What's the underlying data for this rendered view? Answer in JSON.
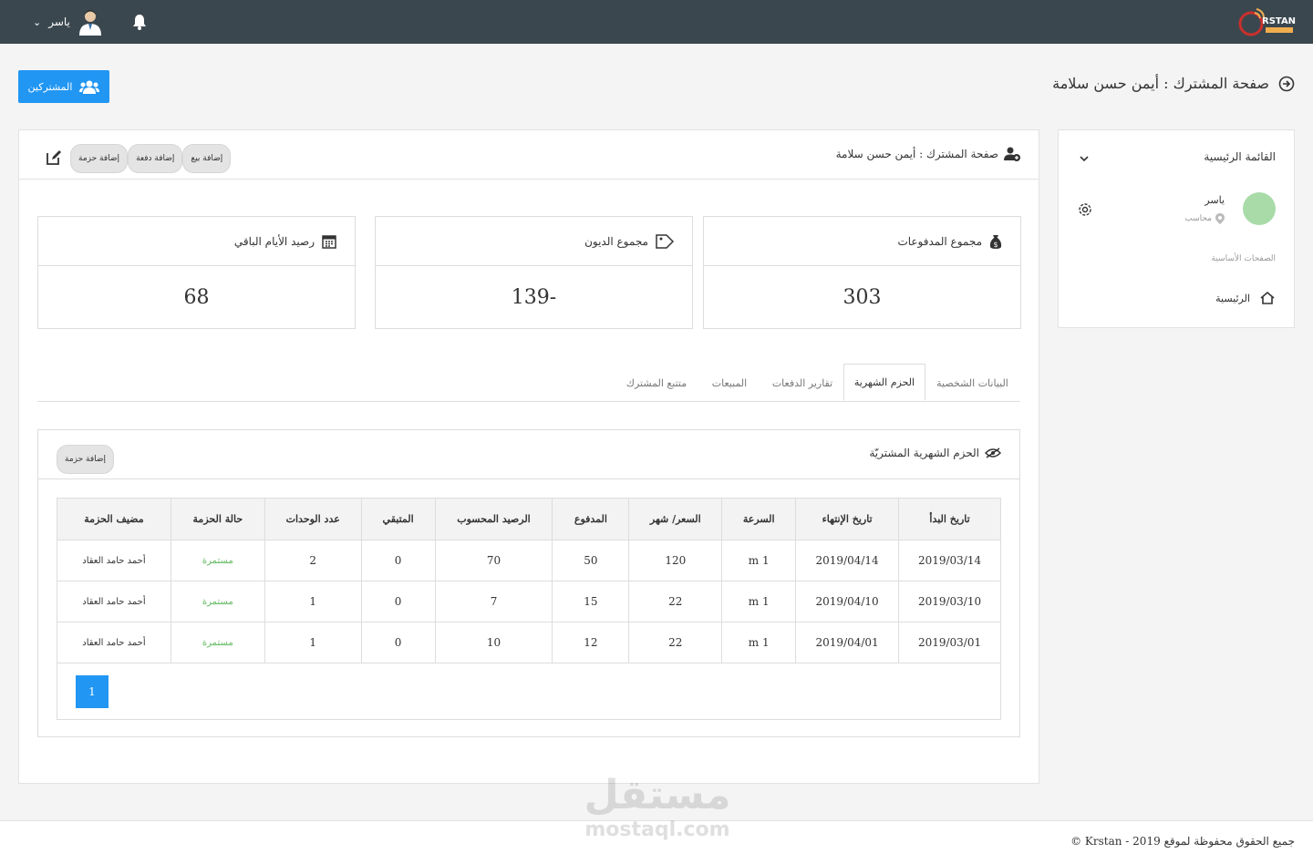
{
  "topbar": {
    "user_name": "ياسر"
  },
  "page": {
    "title": "صفحة المشترك : أيمن حسن سلامة",
    "subscribers_button": "المشتركين"
  },
  "sidebar": {
    "heading": "القائمة الرئيسية",
    "user_name": "ياسر",
    "user_role": "محاسب",
    "section_label": "الصفحات الأساسية",
    "home_label": "الرئيسية"
  },
  "card": {
    "title": "صفحة المشترك : أيمن حسن سلامة",
    "actions": [
      "إضافة بيع",
      "إضافة دفعة",
      "إضافة حزمة"
    ]
  },
  "stats": [
    {
      "label": "مجموع المدفوعات",
      "value": "303",
      "icon": "money-bag-icon"
    },
    {
      "label": "مجموع الديون",
      "value": "139-",
      "icon": "tag-icon"
    },
    {
      "label": "رصيد الأيام الباقي",
      "value": "68",
      "icon": "calendar-icon"
    }
  ],
  "tabs": [
    {
      "label": "البيانات الشخصية",
      "active": false
    },
    {
      "label": "الحزم الشهرية",
      "active": true
    },
    {
      "label": "تقارير الدفعات",
      "active": false
    },
    {
      "label": "المبيعات",
      "active": false
    },
    {
      "label": "متتبع المشترك",
      "active": false
    }
  ],
  "packages": {
    "title": "الحزم الشهرية المشتريّة",
    "add_button": "إضافة حزمة",
    "columns": [
      "تاريخ البدأ",
      "تاريخ الإنتهاء",
      "السرعة",
      "السعر/ شهر",
      "المدفوع",
      "الرصيد المحسوب",
      "المتبقي",
      "عدد الوحدات",
      "حالة الحزمة",
      "مضيف الحزمة"
    ],
    "rows": [
      [
        "2019/03/14",
        "2019/04/14",
        "1 m",
        "120",
        "50",
        "70",
        "0",
        "2",
        "مستمرة",
        "أحمد حامد العقاد"
      ],
      [
        "2019/03/10",
        "2019/04/10",
        "1 m",
        "22",
        "15",
        "7",
        "0",
        "1",
        "مستمرة",
        "أحمد حامد العقاد"
      ],
      [
        "2019/03/01",
        "2019/04/01",
        "1 m",
        "22",
        "12",
        "10",
        "0",
        "1",
        "مستمرة",
        "أحمد حامد العقاد"
      ]
    ],
    "page_number": "1"
  },
  "footer": {
    "copyright": "جميع الحقوق محفوظة لموقع Krstan - 2019 ©"
  },
  "brand": {
    "logo_text": "RSTAN"
  },
  "watermark": {
    "arabic": "مستقل",
    "latin": "mostaql.com"
  },
  "colors": {
    "topbar": "#3a474f",
    "primary": "#2196f3",
    "success": "#5cb85c"
  }
}
